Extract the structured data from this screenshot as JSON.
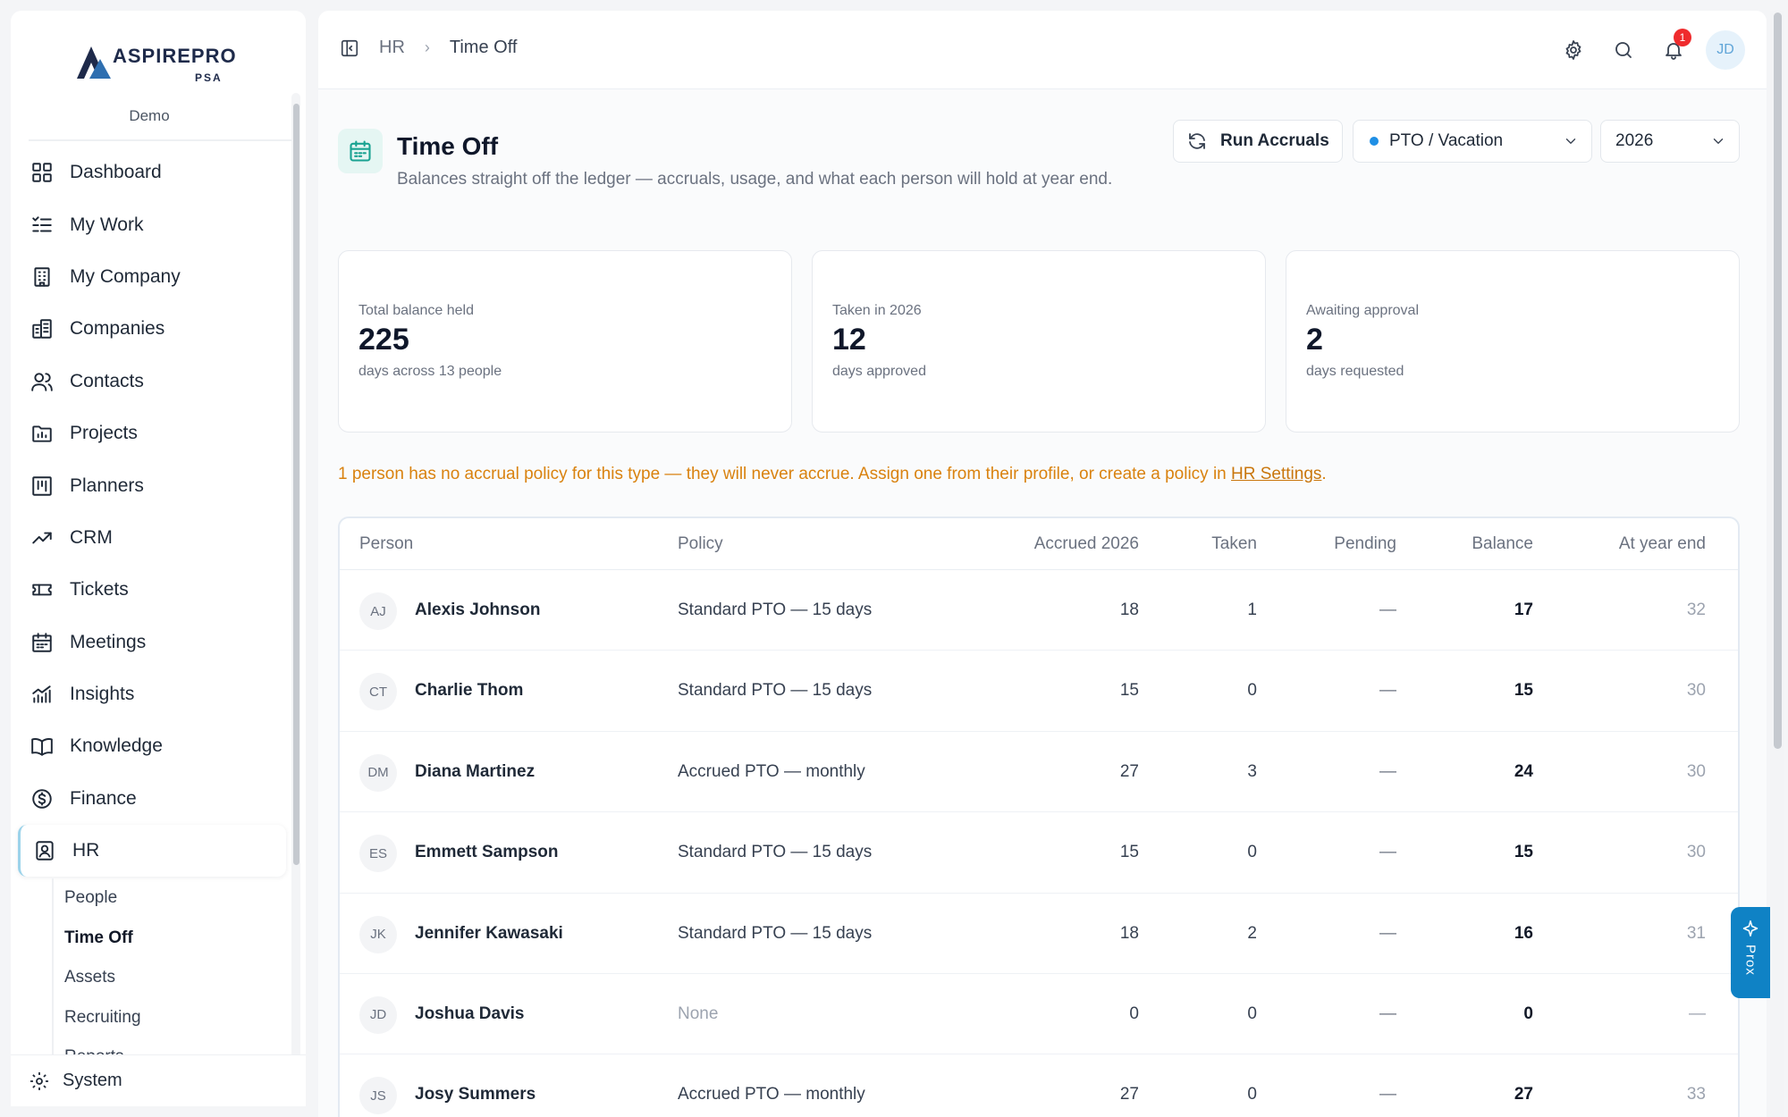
{
  "brand": {
    "name": "ASPIREPRO",
    "sub": "PSA",
    "org": "Demo"
  },
  "sidebar": {
    "items": [
      {
        "label": "Dashboard",
        "icon": "dashboard-icon"
      },
      {
        "label": "My Work",
        "icon": "list-check-icon"
      },
      {
        "label": "My Company",
        "icon": "building-icon"
      },
      {
        "label": "Companies",
        "icon": "buildings-icon"
      },
      {
        "label": "Contacts",
        "icon": "users-icon"
      },
      {
        "label": "Projects",
        "icon": "folder-chart-icon"
      },
      {
        "label": "Planners",
        "icon": "kanban-icon"
      },
      {
        "label": "CRM",
        "icon": "trend-up-icon"
      },
      {
        "label": "Tickets",
        "icon": "ticket-icon"
      },
      {
        "label": "Meetings",
        "icon": "calendar-icon"
      },
      {
        "label": "Insights",
        "icon": "bar-chart-icon"
      },
      {
        "label": "Knowledge",
        "icon": "book-icon"
      },
      {
        "label": "Finance",
        "icon": "dollar-circle-icon"
      },
      {
        "label": "HR",
        "icon": "id-badge-icon"
      }
    ],
    "active": "HR",
    "subitems": [
      "People",
      "Time Off",
      "Assets",
      "Recruiting",
      "Reports"
    ],
    "current_sub": "Time Off",
    "system_label": "System"
  },
  "topbar": {
    "crumbs": [
      "HR",
      "Time Off"
    ],
    "notifications_count": "1",
    "user_initials": "JD"
  },
  "page": {
    "title": "Time Off",
    "subtitle": "Balances straight off the ledger — accruals, usage, and what each person will hold at year end.",
    "run_label": "Run Accruals",
    "type_value": "PTO / Vacation",
    "type_color": "#1f8fe5",
    "year_value": "2026"
  },
  "stats": [
    {
      "label": "Total balance held",
      "value": "225",
      "note": "days across 13 people"
    },
    {
      "label": "Taken in 2026",
      "value": "12",
      "note": "days approved"
    },
    {
      "label": "Awaiting approval",
      "value": "2",
      "note": "days requested"
    }
  ],
  "warning": {
    "text": "1 person has no accrual policy for this type — they will never accrue. Assign one from their profile, or create a policy in ",
    "link": "HR Settings",
    "tail": "."
  },
  "table": {
    "headers": {
      "person": "Person",
      "policy": "Policy",
      "accrued": "Accrued 2026",
      "taken": "Taken",
      "pending": "Pending",
      "balance": "Balance",
      "year_end": "At year end"
    },
    "rows": [
      {
        "initials": "AJ",
        "name": "Alexis Johnson",
        "policy": "Standard PTO — 15 days",
        "accrued": "18",
        "taken": "1",
        "pending": "—",
        "balance": "17",
        "year_end": "32"
      },
      {
        "initials": "CT",
        "name": "Charlie Thom",
        "policy": "Standard PTO — 15 days",
        "accrued": "15",
        "taken": "0",
        "pending": "—",
        "balance": "15",
        "year_end": "30"
      },
      {
        "initials": "DM",
        "name": "Diana Martinez",
        "policy": "Accrued PTO — monthly",
        "accrued": "27",
        "taken": "3",
        "pending": "—",
        "balance": "24",
        "year_end": "30"
      },
      {
        "initials": "ES",
        "name": "Emmett Sampson",
        "policy": "Standard PTO — 15 days",
        "accrued": "15",
        "taken": "0",
        "pending": "—",
        "balance": "15",
        "year_end": "30"
      },
      {
        "initials": "JK",
        "name": "Jennifer Kawasaki",
        "policy": "Standard PTO — 15 days",
        "accrued": "18",
        "taken": "2",
        "pending": "—",
        "balance": "16",
        "year_end": "31"
      },
      {
        "initials": "JD",
        "name": "Joshua Davis",
        "policy": "None",
        "accrued": "0",
        "taken": "0",
        "pending": "—",
        "balance": "0",
        "year_end": "—"
      },
      {
        "initials": "JS",
        "name": "Josy Summers",
        "policy": "Accrued PTO — monthly",
        "accrued": "27",
        "taken": "0",
        "pending": "—",
        "balance": "27",
        "year_end": "33"
      }
    ]
  },
  "prox_label": "Prox"
}
